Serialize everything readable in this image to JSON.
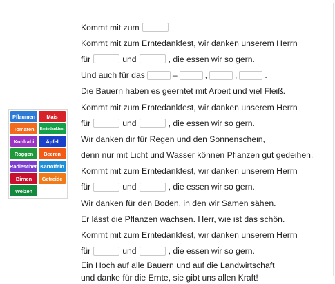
{
  "word_bank": [
    {
      "label": "Pflaumen",
      "color": "#2e7bd6"
    },
    {
      "label": "Mais",
      "color": "#d8222a"
    },
    {
      "label": "Tomaten",
      "color": "#f26a1b"
    },
    {
      "label": "Erntedankfest",
      "color": "#14a049"
    },
    {
      "label": "Kohlrabi",
      "color": "#9b33c4"
    },
    {
      "label": "Äpfel",
      "color": "#1a3fc9"
    },
    {
      "label": "Roggen",
      "color": "#1f9a3a"
    },
    {
      "label": "Beeren",
      "color": "#f35a16"
    },
    {
      "label": "Radieschen",
      "color": "#7d3fd0"
    },
    {
      "label": "Kartoffeln",
      "color": "#1f8fd8"
    },
    {
      "label": "Birnen",
      "color": "#c8102e"
    },
    {
      "label": "Getreide",
      "color": "#f07a18"
    },
    {
      "label": "Weizen",
      "color": "#128a3e"
    }
  ],
  "text": {
    "l1a": "Kommt mit zum",
    "l2": "Kommt mit zum Erntedankfest, wir danken unserem Herrn",
    "fuer": "für",
    "und": "und",
    "essen": ", die essen wir so gern.",
    "l4a": "Und auch für das",
    "dash": "–",
    "comma": ",",
    "period": ".",
    "l5": "Die Bauern haben es geerntet mit Arbeit und viel Fleiß.",
    "l8": "Wir danken dir für Regen und den Sonnenschein,",
    "l9": "denn nur mit Licht und Wasser können Pflanzen gut gedeihen.",
    "l12": "Wir danken für den Boden, in den wir Samen sähen.",
    "l13": "Er lässt die Pflanzen wachsen. Herr, wie ist das schön.",
    "l16": "Ein Hoch auf alle Bauern und auf die Landwirtschaft",
    "l17": "und danke für die Ernte, sie gibt uns allen Kraft!"
  }
}
